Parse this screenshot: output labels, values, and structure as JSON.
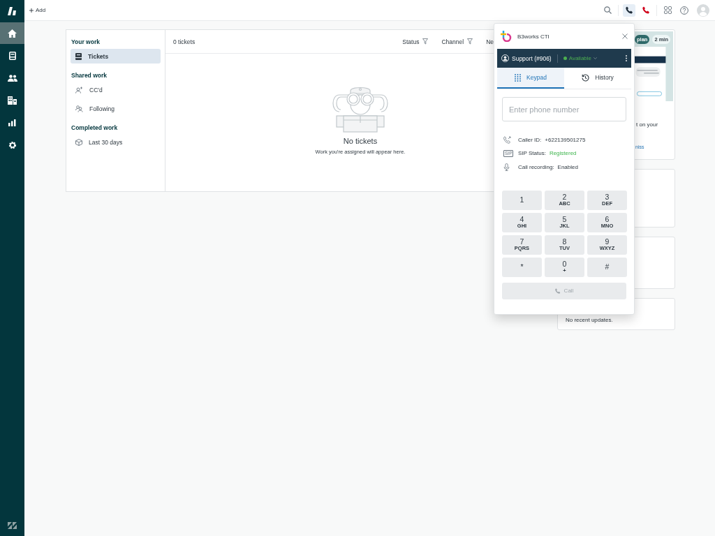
{
  "nav": {
    "items": [
      {
        "kind": "home",
        "selected": true
      },
      {
        "kind": "views",
        "selected": false
      },
      {
        "kind": "customers",
        "selected": false
      },
      {
        "kind": "organizations",
        "selected": false
      },
      {
        "kind": "reporting",
        "selected": false
      },
      {
        "kind": "admin",
        "selected": false
      }
    ]
  },
  "topbar": {
    "add_label": "Add",
    "tools": [
      {
        "kind": "search",
        "selected": false
      },
      {
        "kind": "phone",
        "selected": true
      },
      {
        "kind": "hangup",
        "selected": false
      },
      {
        "kind": "apps",
        "selected": false
      },
      {
        "kind": "help",
        "selected": false
      },
      {
        "kind": "avatar",
        "selected": false
      }
    ]
  },
  "sidebar": [
    {
      "title": "Your work",
      "items": [
        {
          "label": "Tickets",
          "kind": "ticket",
          "selected": true
        }
      ]
    },
    {
      "title": "Shared work",
      "items": [
        {
          "label": "CC'd",
          "kind": "cc",
          "selected": false
        },
        {
          "label": "Following",
          "kind": "following",
          "selected": false
        }
      ]
    },
    {
      "title": "Completed work",
      "items": [
        {
          "label": "Last 30 days",
          "kind": "cube",
          "selected": false
        }
      ]
    }
  ],
  "tickets": {
    "count": "0 tickets",
    "filters": [
      {
        "label": "Status",
        "funnel": true
      },
      {
        "label": "Channel",
        "funnel": true
      },
      {
        "label": "Ne",
        "funnel": false
      }
    ],
    "empty_title": "No tickets",
    "empty_text": "Work you're assigned will appear here."
  },
  "right_cards": [
    {
      "kind": "promo",
      "badges": [
        "plan",
        "2 min"
      ],
      "text": "t on your",
      "link": "niss"
    },
    {
      "kind": "blank"
    },
    {
      "kind": "blank"
    },
    {
      "kind": "text",
      "text": "No recent updates."
    }
  ],
  "cti": {
    "title": "B3works CTI",
    "queue": "Support (#906)",
    "status": "Available",
    "tabs": [
      {
        "label": "Keypad",
        "kind": "keypad",
        "selected": true
      },
      {
        "label": "History",
        "kind": "history",
        "selected": false
      }
    ],
    "phone_field": {
      "placeholder": "Enter phone number"
    },
    "info": [
      {
        "kind": "caller",
        "label": "Caller ID:",
        "value": "+622139501275",
        "ok": false
      },
      {
        "kind": "sip",
        "badge": "SIP",
        "label": "SIP Status:",
        "value": "Registered",
        "ok": true
      },
      {
        "kind": "mic",
        "label": "Call recording:",
        "value": "Enabled",
        "ok": false
      }
    ],
    "keys": [
      {
        "digit": "1"
      },
      {
        "digit": "2",
        "letters": "ABC"
      },
      {
        "digit": "3",
        "letters": "DEF"
      },
      {
        "digit": "4",
        "letters": "GHI"
      },
      {
        "digit": "5",
        "letters": "JKL"
      },
      {
        "digit": "6",
        "letters": "MNO"
      },
      {
        "digit": "7",
        "letters": "PQRS"
      },
      {
        "digit": "8",
        "letters": "TUV"
      },
      {
        "digit": "9",
        "letters": "WXYZ"
      },
      {
        "digit": "*"
      },
      {
        "digit": "0",
        "letters": "+"
      },
      {
        "digit": "#"
      }
    ],
    "call_button": {
      "label": "Call",
      "disabled": true
    }
  }
}
